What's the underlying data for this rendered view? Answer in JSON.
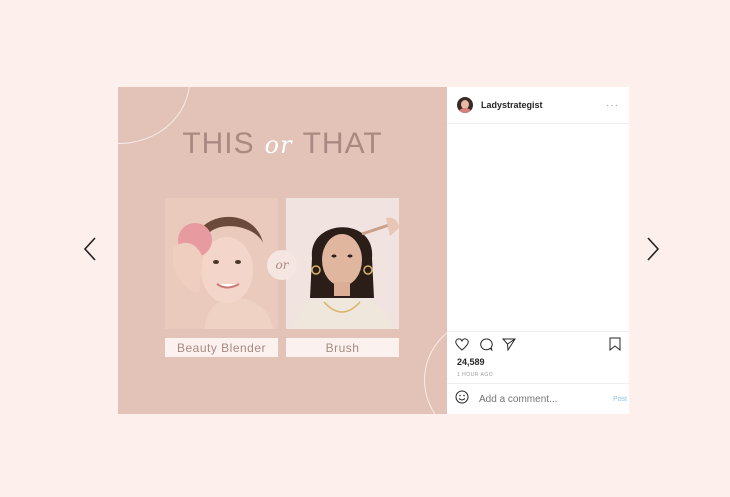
{
  "nav": {
    "prev_icon": "chevron-left-icon",
    "next_icon": "chevron-right-icon"
  },
  "media": {
    "headline_left": "THIS",
    "headline_or": "or",
    "headline_right": "THAT",
    "or_badge": "or",
    "left_label": "Beauty Blender",
    "right_label": "Brush"
  },
  "panel": {
    "username": "Ladystrategist",
    "more": "···",
    "likes": "24,589",
    "time": "1 HOUR AGO",
    "comment_placeholder": "Add a comment...",
    "post_label": "Post"
  },
  "colors": {
    "background": "#fcefec",
    "media_bg": "#e3c2b8",
    "headline": "#a98a82",
    "post_link": "#8fc1e3"
  }
}
